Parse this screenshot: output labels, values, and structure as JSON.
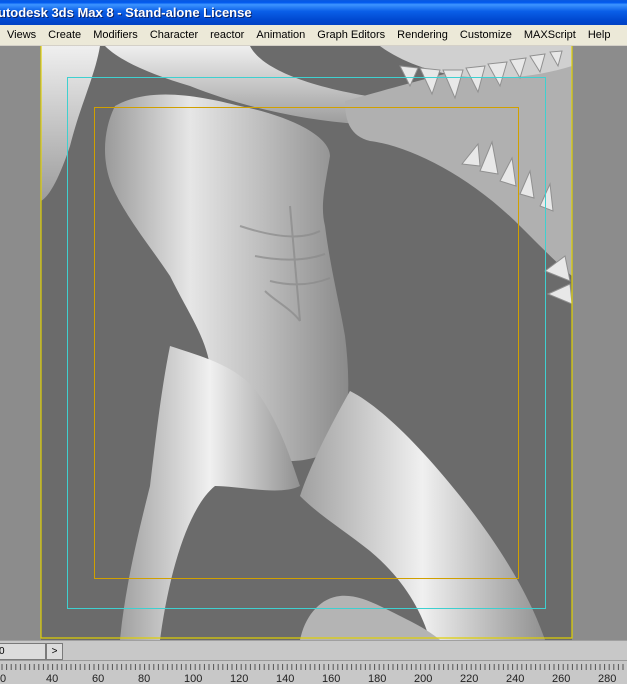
{
  "window": {
    "title": "utodesk 3ds Max 8  - Stand-alone License"
  },
  "menu": {
    "items": [
      "Views",
      "Create",
      "Modifiers",
      "Character",
      "reactor",
      "Animation",
      "Graph Editors",
      "Rendering",
      "Customize",
      "MAXScript",
      "Help"
    ]
  },
  "viewport": {
    "safe_frame_colors": {
      "outer": "#e0d000",
      "action": "#3fd0d0",
      "title": "#d0a000"
    },
    "background_color": "#8c8c8c",
    "model_color": "#c8c8c8"
  },
  "time_controls": {
    "frame_value": "0",
    "next_glyph": ">"
  },
  "timeline": {
    "tick_labels": [
      "0",
      "40",
      "60",
      "80",
      "100",
      "120",
      "140",
      "160",
      "180",
      "200",
      "220",
      "240",
      "260",
      "280"
    ]
  }
}
